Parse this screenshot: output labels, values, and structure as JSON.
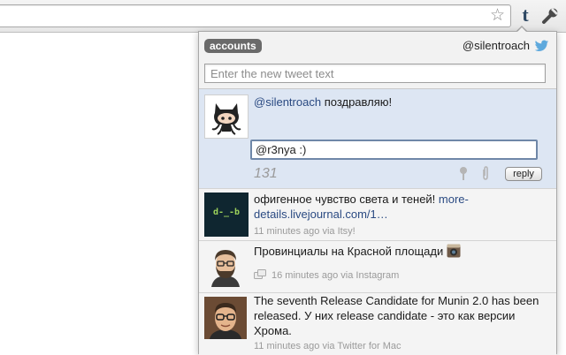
{
  "browser": {
    "toolbar_icons": [
      "star-icon",
      "tumblr-extension-icon",
      "wrench-icon"
    ],
    "extension_letter": "t"
  },
  "popup": {
    "accounts_label": "accounts",
    "current_account": "@silentroach",
    "new_tweet_placeholder": "Enter the new tweet text",
    "tweets": [
      {
        "mention": "@silentroach",
        "text": " поздравляю!",
        "reply_value": "@r3nya :)",
        "char_count": "131",
        "reply_label": "reply",
        "avatar": "octocat"
      },
      {
        "text": "офигенное чувство света и теней! ",
        "link": "more-details.livejournal.com/1…",
        "meta": "11 minutes ago via Itsy!",
        "avatar_text": "d-_-b"
      },
      {
        "text": "Провинциалы на Красной площади",
        "meta": "16 minutes ago via Instagram",
        "avatar": "bearded-man"
      },
      {
        "text": "The seventh Release Candidate for Munin 2.0 has been released. У них release candidate - это как версии Хрома.",
        "meta": "11 minutes ago via Twitter for Mac",
        "avatar": "man-with-glasses"
      }
    ]
  },
  "colors": {
    "selected_row": "#dde6f3",
    "link": "#2a4a82",
    "accounts_badge": "#6a6a6a"
  }
}
